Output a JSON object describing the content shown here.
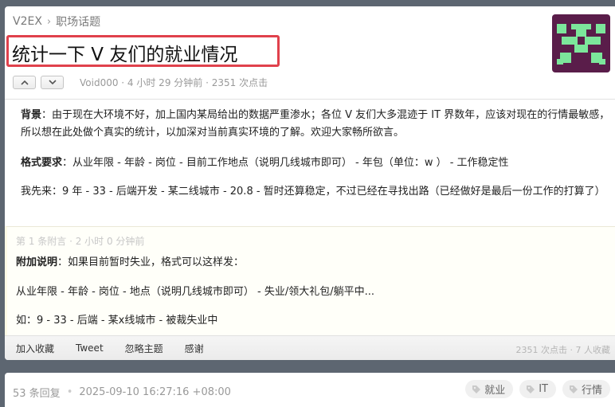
{
  "breadcrumb": {
    "site": "V2EX",
    "separator": "›",
    "node": "职场话题"
  },
  "topic": {
    "title": "统计一下 V 友们的就业情况",
    "meta": "Void000 · 4 小时 29 分钟前 · 2351 次点击",
    "avatar_colors": {
      "background": "#5a1d4a",
      "foreground": "#7ce69b"
    }
  },
  "content": {
    "p1_label": "背景",
    "p1_text": "：由于现在大环境不好，加上国内某局给出的数据严重渗水；各位 V 友们大多混迹于 IT 界数年，应该对现在的行情最敏感，所以想在此处做个真实的统计，以加深对当前真实环境的了解。欢迎大家畅所欲言。",
    "p2_label": "格式要求",
    "p2_text": "：从业年限 - 年龄 - 岗位 - 目前工作地点（说明几线城市即可） - 年包（单位：w ） - 工作稳定性",
    "p3_text": "我先来：9 年 - 33 - 后端开发 - 某二线城市 - 20.8 - 暂时还算稳定，不过已经在寻找出路（已经做好是最后一份工作的打算了）"
  },
  "supplement": {
    "header": "第 1 条附言 · 2 小时 0 分钟前",
    "p1_label": "附加说明",
    "p1_text": "：如果目前暂时失业，格式可以这样发：",
    "p2_text": "从业年限 - 年龄 - 岗位 - 地点（说明几线城市即可） - 失业/领大礼包/躺平中...",
    "p3_text": "如：9 - 33 - 后端 - 某x线城市 - 被裁失业中"
  },
  "footer": {
    "actions": [
      "加入收藏",
      "Tweet",
      "忽略主题",
      "感谢"
    ],
    "stats": "2351 次点击 · 7 人收藏"
  },
  "replies": {
    "count": "53 条回复",
    "separator": "•",
    "timestamp": "2025-09-10 16:27:16 +08:00",
    "tags": [
      "就业",
      "IT",
      "行情"
    ]
  }
}
